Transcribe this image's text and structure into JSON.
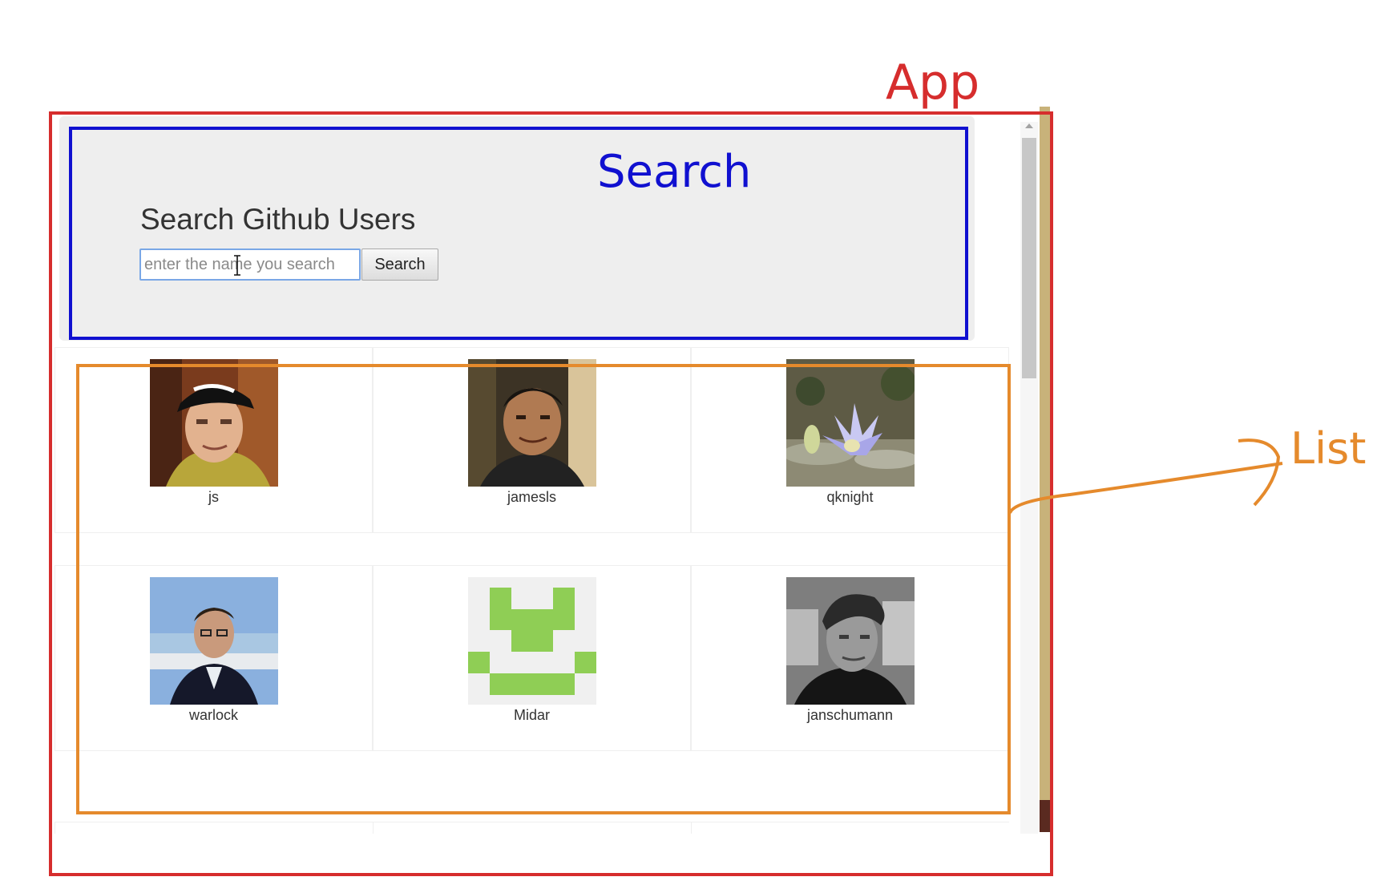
{
  "annotations": {
    "app_label": "App",
    "search_label": "Search",
    "list_label": "List",
    "colors": {
      "app": "#d62d2d",
      "search": "#1010d0",
      "list": "#e58a2c"
    }
  },
  "search": {
    "title": "Search Github Users",
    "placeholder": "enter the name you search",
    "button_label": "Search"
  },
  "users": [
    {
      "login": "js",
      "avatar": "person-with-cap-photo"
    },
    {
      "login": "jamesls",
      "avatar": "person-photo"
    },
    {
      "login": "qknight",
      "avatar": "water-lily-photo"
    },
    {
      "login": "warlock",
      "avatar": "person-suit-photo"
    },
    {
      "login": "Midar",
      "avatar": "green-identicon"
    },
    {
      "login": "janschumann",
      "avatar": "grayscale-person-photo"
    }
  ]
}
